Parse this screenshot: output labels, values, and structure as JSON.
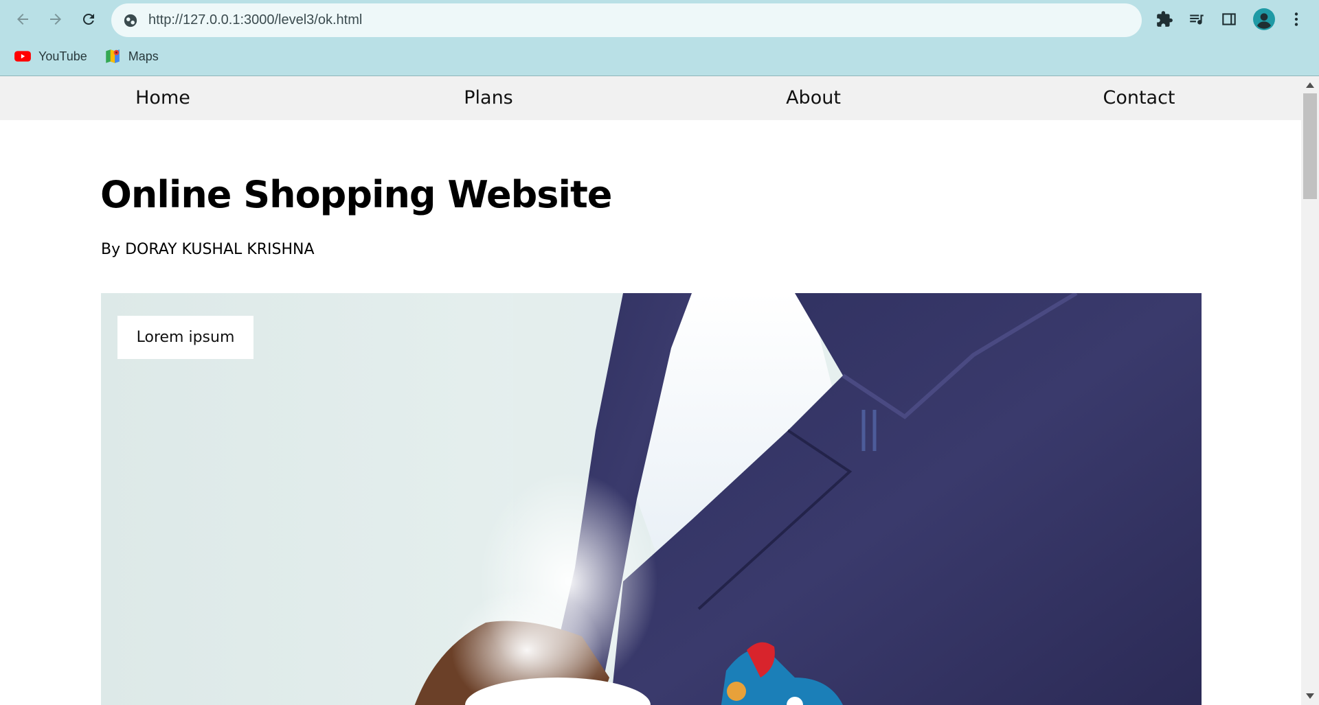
{
  "browser": {
    "url": "http://127.0.0.1:3000/level3/ok.html",
    "chrome_color": "#b9e0e6",
    "bookmarks": [
      {
        "label": "YouTube",
        "icon": "youtube-icon"
      },
      {
        "label": "Maps",
        "icon": "maps-icon"
      }
    ],
    "toolbar_icons": [
      "back-arrow-icon",
      "forward-arrow-icon",
      "reload-icon",
      "site-info-icon",
      "extensions-icon",
      "media-icon",
      "side-panel-icon",
      "profile-icon",
      "menu-icon"
    ]
  },
  "nav": {
    "items": [
      {
        "label": "Home"
      },
      {
        "label": "Plans"
      },
      {
        "label": "About"
      },
      {
        "label": "Contact"
      }
    ],
    "background": "#f1f1f1"
  },
  "main": {
    "title": "Online Shopping Website",
    "byline": "By DORAY KUSHAL KRISHNA",
    "hero": {
      "badge_label": "Lorem ipsum"
    }
  }
}
